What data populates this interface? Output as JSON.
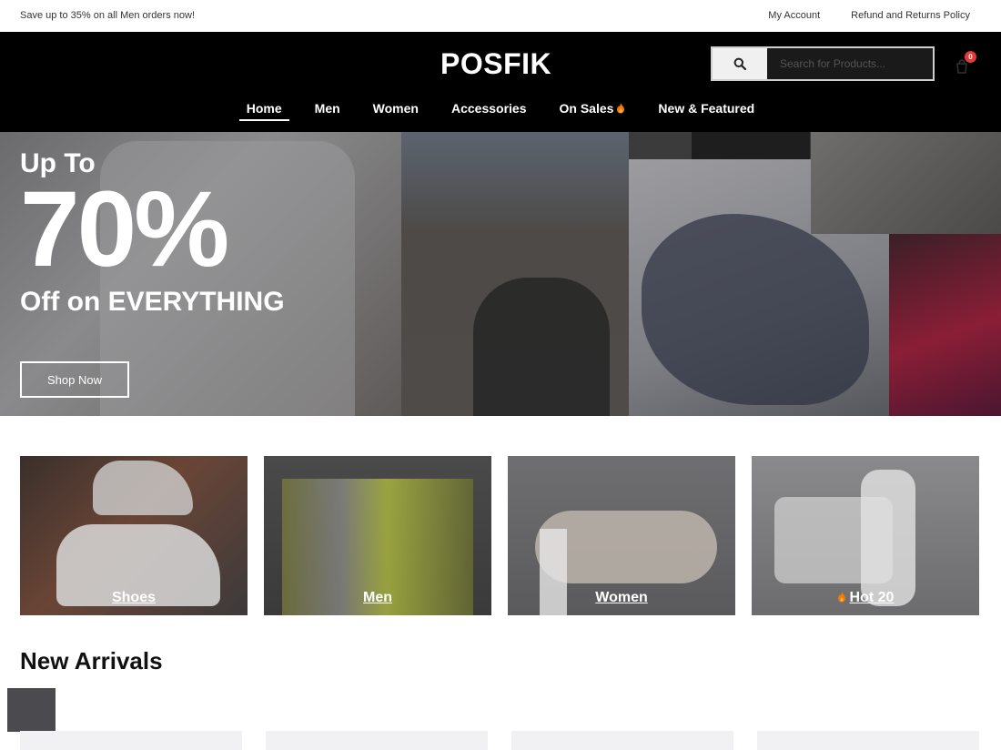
{
  "topbar": {
    "promo": "Save up to 35% on all Men orders now!",
    "my_account": "My Account",
    "refund_policy": "Refund and Returns Policy"
  },
  "header": {
    "logo": "POSFIK",
    "search_placeholder": "Search for Products...",
    "cart_count": "0"
  },
  "nav": {
    "items": [
      {
        "label": "Home",
        "active": true
      },
      {
        "label": "Men"
      },
      {
        "label": "Women"
      },
      {
        "label": "Accessories"
      },
      {
        "label": "On Sales",
        "icon": "flame-icon"
      },
      {
        "label": "New & Featured"
      }
    ]
  },
  "hero": {
    "line1": "Up To",
    "line2": "70%",
    "line3": "Off on EVERYTHING",
    "cta": "Shop Now"
  },
  "categories": [
    {
      "label": "Shoes"
    },
    {
      "label": "Men"
    },
    {
      "label": "Women"
    },
    {
      "label": "Hot 20",
      "icon": "flame-icon"
    }
  ],
  "arrivals": {
    "title": "New Arrivals"
  },
  "colors": {
    "header_bg": "#000000",
    "badge": "#e53935",
    "flame": "#f57c00"
  }
}
